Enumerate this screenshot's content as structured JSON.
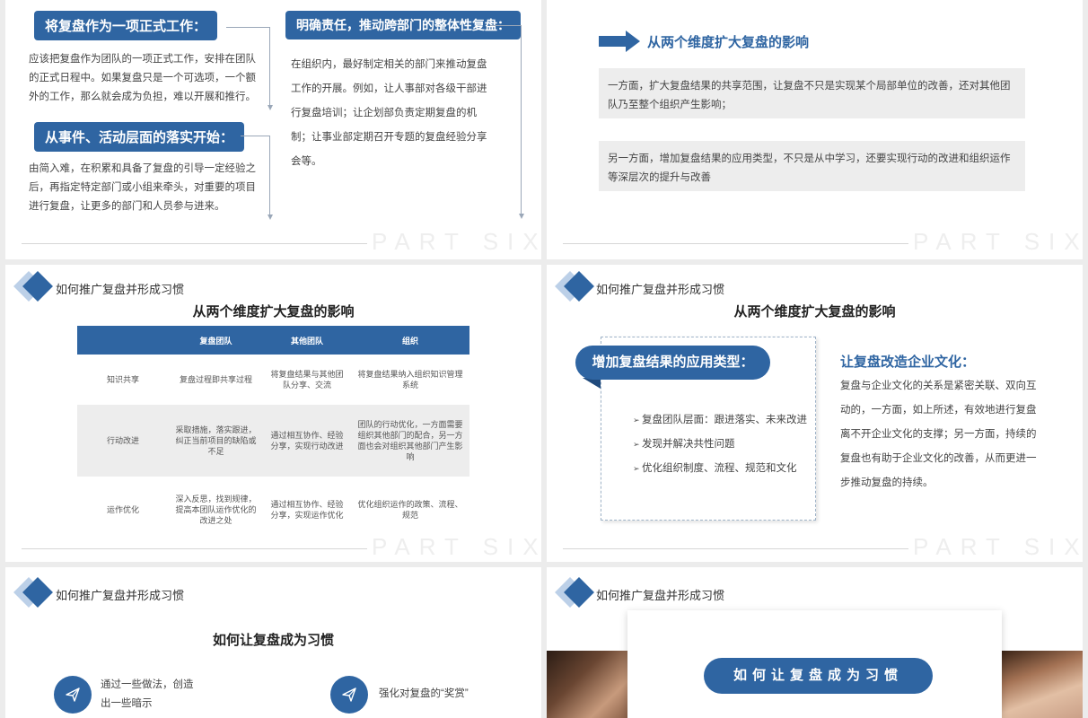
{
  "footer_text": "PART SIX",
  "s1": {
    "left_title_1": "将复盘作为一项正式工作：",
    "left_body_1": "应该把复盘作为团队的一项正式工作，安排在团队的正式日程中。如果复盘只是一个可选项，一个额外的工作，那么就会成为负担，难以开展和推行。",
    "left_title_2": "从事件、活动层面的落实开始：",
    "left_body_2": "由简入难，在积累和具备了复盘的引导一定经验之后，再指定特定部门或小组来牵头，对重要的项目进行复盘，让更多的部门和人员参与进来。",
    "right_title": "明确责任，推动跨部门的整体性复盘：",
    "right_body": "在组织内，最好制定相关的部门来推动复盘工作的开展。例如，让人事部对各级干部进行复盘培训；让企划部负责定期复盘的机制；让事业部定期召开专题的复盘经验分享会等。"
  },
  "s2": {
    "heading": "从两个维度扩大复盘的影响",
    "box1": "一方面，扩大复盘结果的共享范围，让复盘不只是实现某个局部单位的改善，还对其他团队乃至整个组织产生影响；",
    "box2": "另一方面，增加复盘结果的应用类型，不只是从中学习，还要实现行动的改进和组织运作等深层次的提升与改善"
  },
  "s3": {
    "header": "如何推广复盘并形成习惯",
    "title": "从两个维度扩大复盘的影响",
    "columns": [
      "",
      "复盘团队",
      "其他团队",
      "组织"
    ],
    "rows": [
      [
        "知识共享",
        "复盘过程即共享过程",
        "将复盘结果与其他团队分享、交流",
        "将复盘结果纳入组织知识管理系统"
      ],
      [
        "行动改进",
        "采取措施，落实跟进，纠正当前项目的缺陷或不足",
        "通过相互协作、经验分享，实现行动改进",
        "团队的行动优化，一方面需要组织其他部门的配合，另一方面也会对组织其他部门产生影响"
      ],
      [
        "运作优化",
        "深入反思，找到规律，提高本团队运作优化的改进之处",
        "通过相互协作、经验分享，实现运作优化",
        "优化组织运作的政策、流程、规范"
      ]
    ]
  },
  "s4": {
    "header": "如何推广复盘并形成习惯",
    "title": "从两个维度扩大复盘的影响",
    "bubble": "增加复盘结果的应用类型：",
    "bullets": [
      "复盘团队层面：跟进落实、未来改进",
      "发现并解决共性问题",
      "优化组织制度、流程、规范和文化"
    ],
    "right_title": "让复盘改造企业文化：",
    "right_body": "复盘与企业文化的关系是紧密关联、双向互动的，一方面，如上所述，有效地进行复盘离不开企业文化的支撑；另一方面，持续的复盘也有助于企业文化的改善，从而更进一步推动复盘的持续。"
  },
  "s5": {
    "header": "如何推广复盘并形成习惯",
    "title": "如何让复盘成为习惯",
    "item1": "通过一些做法，创造出一些暗示",
    "item2": "强化对复盘的“奖赏”"
  },
  "s6": {
    "header": "如何推广复盘并形成习惯",
    "banner": "如何让复盘成为习惯"
  },
  "colors": {
    "accent": "#2f65a2",
    "grey_box": "#ededed"
  },
  "icons": {
    "plane": "paper-plane-icon",
    "bullet": "triangle-bullet-icon"
  }
}
